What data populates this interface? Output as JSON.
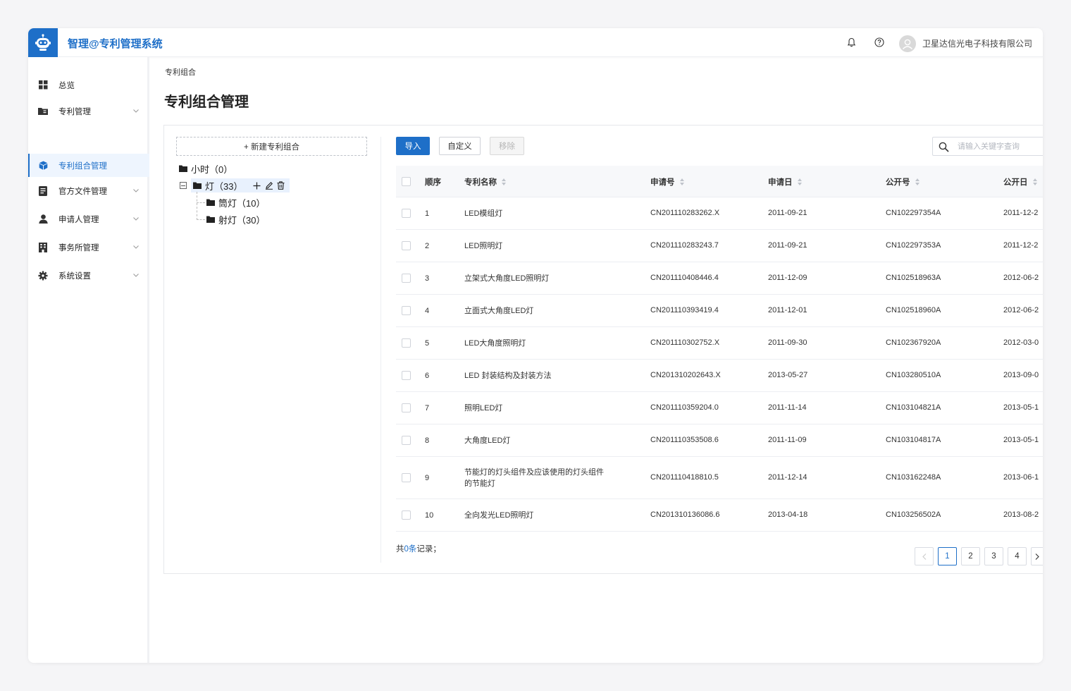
{
  "header": {
    "app_title": "智理@专利管理系统",
    "company": "卫星达信光电子科技有限公司"
  },
  "sidebar": {
    "items": [
      {
        "label": "总览",
        "icon": "dashboard-icon"
      },
      {
        "label": "专利管理",
        "icon": "folder-icon"
      },
      {
        "label": "专利组合管理",
        "icon": "cube-icon",
        "active": true
      },
      {
        "label": "官方文件管理",
        "icon": "document-icon"
      },
      {
        "label": "申请人管理",
        "icon": "user-icon"
      },
      {
        "label": "事务所管理",
        "icon": "building-icon"
      },
      {
        "label": "系统设置",
        "icon": "gear-icon"
      }
    ]
  },
  "breadcrumb": "专利组合",
  "page_title": "专利组合管理",
  "tree": {
    "new_group_label": "+ 新建专利组合",
    "nodes": [
      {
        "label": "小时（0）"
      },
      {
        "label": "灯（33）",
        "selected": true
      },
      {
        "label": "筒灯（10）"
      },
      {
        "label": "射灯（30）"
      }
    ]
  },
  "toolbar": {
    "import_label": "导入",
    "custom_label": "自定义",
    "remove_label": "移除",
    "search_placeholder": "请输入关键字查询"
  },
  "table": {
    "columns": [
      "顺序",
      "专利名称",
      "申请号",
      "申请日",
      "公开号",
      "公开日"
    ],
    "rows": [
      {
        "no": "1",
        "name": "LED模组灯",
        "app_no": "CN201110283262.X",
        "app_date": "2011-09-21",
        "pub_no": "CN102297354A",
        "pub_date": "2011-12-2"
      },
      {
        "no": "2",
        "name": "LED照明灯",
        "app_no": "CN201110283243.7",
        "app_date": "2011-09-21",
        "pub_no": "CN102297353A",
        "pub_date": "2011-12-2"
      },
      {
        "no": "3",
        "name": "立架式大角度LED照明灯",
        "app_no": "CN201110408446.4",
        "app_date": "2011-12-09",
        "pub_no": "CN102518963A",
        "pub_date": "2012-06-2"
      },
      {
        "no": "4",
        "name": "立面式大角度LED灯",
        "app_no": "CN201110393419.4",
        "app_date": "2011-12-01",
        "pub_no": "CN102518960A",
        "pub_date": "2012-06-2"
      },
      {
        "no": "5",
        "name": "LED大角度照明灯",
        "app_no": "CN201110302752.X",
        "app_date": "2011-09-30",
        "pub_no": "CN102367920A",
        "pub_date": "2012-03-0"
      },
      {
        "no": "6",
        "name": "LED 封装结构及封装方法",
        "app_no": "CN201310202643.X",
        "app_date": "2013-05-27",
        "pub_no": "CN103280510A",
        "pub_date": "2013-09-0"
      },
      {
        "no": "7",
        "name": "照明LED灯",
        "app_no": "CN201110359204.0",
        "app_date": "2011-11-14",
        "pub_no": "CN103104821A",
        "pub_date": "2013-05-1"
      },
      {
        "no": "8",
        "name": "大角度LED灯",
        "app_no": "CN201110353508.6",
        "app_date": "2011-11-09",
        "pub_no": "CN103104817A",
        "pub_date": "2013-05-1"
      },
      {
        "no": "9",
        "name": "节能灯的灯头组件及应该使用的灯头组件的节能灯",
        "app_no": "CN201110418810.5",
        "app_date": "2011-12-14",
        "pub_no": "CN103162248A",
        "pub_date": "2013-06-1"
      },
      {
        "no": "10",
        "name": "全向发光LED照明灯",
        "app_no": "CN201310136086.6",
        "app_date": "2013-04-18",
        "pub_no": "CN103256502A",
        "pub_date": "2013-08-2"
      }
    ]
  },
  "footer": {
    "total_prefix": "共",
    "total_count": "0条",
    "total_suffix": "记录；"
  },
  "pagination": {
    "pages": [
      "1",
      "2",
      "3",
      "4"
    ],
    "current": "1"
  },
  "colors": {
    "primary": "#1e6fc8"
  }
}
